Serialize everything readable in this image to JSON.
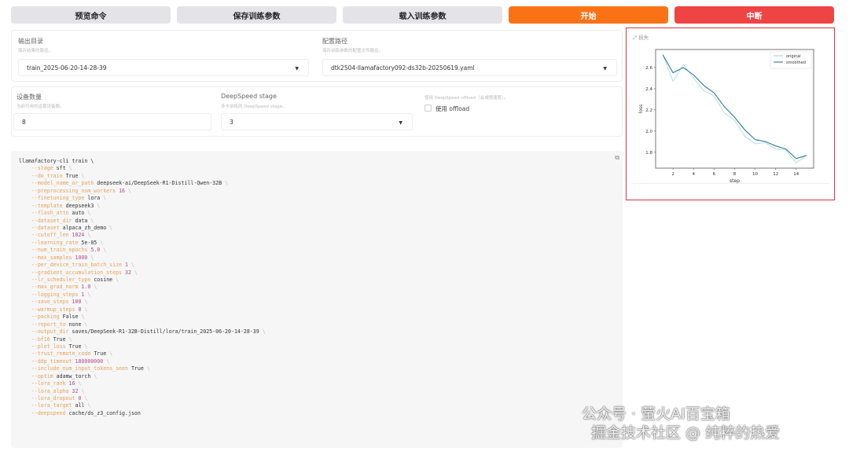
{
  "toolbar": {
    "preview": "预览命令",
    "save": "保存训练参数",
    "load": "载入训练参数",
    "start": "开始",
    "abort": "中断"
  },
  "output_dir": {
    "label": "输出目录",
    "info": "保存结果的路径。",
    "value": "train_2025-06-20-14-28-39"
  },
  "config_path": {
    "label": "配置路径",
    "info": "保存训练参数的配置文件路径。",
    "value": "dtk2504-llamafactory092-ds32b-20250619.yaml"
  },
  "device_count": {
    "label": "设备数量",
    "info": "当前可用的运算设备数。",
    "value": "8"
  },
  "ds_stage": {
    "label": "DeepSpeed stage",
    "info": "多卡训练的 DeepSpeed stage。",
    "value": "3"
  },
  "ds_offload": {
    "info": "使用 DeepSpeed offload（会减慢速度）。",
    "label": "使用 offload",
    "checked": false
  },
  "command": {
    "head": "llamafactory-cli train \\",
    "args": [
      [
        "--stage",
        "sft",
        false
      ],
      [
        "--do_train",
        "True",
        false
      ],
      [
        "--model_name_or_path",
        "deepseek-ai/DeepSeek-R1-Distill-Qwen-32B",
        false
      ],
      [
        "--preprocessing_num_workers",
        "16",
        true
      ],
      [
        "--finetuning_type",
        "lora",
        false
      ],
      [
        "--template",
        "deepseek3",
        false
      ],
      [
        "--flash_attn",
        "auto",
        false
      ],
      [
        "--dataset_dir",
        "data",
        false
      ],
      [
        "--dataset",
        "alpaca_zh_demo",
        false
      ],
      [
        "--cutoff_len",
        "1024",
        true
      ],
      [
        "--learning_rate",
        "5e-05",
        false
      ],
      [
        "--num_train_epochs",
        "5.0",
        true
      ],
      [
        "--max_samples",
        "1000",
        true
      ],
      [
        "--per_device_train_batch_size",
        "1",
        true
      ],
      [
        "--gradient_accumulation_steps",
        "32",
        true
      ],
      [
        "--lr_scheduler_type",
        "cosine",
        false
      ],
      [
        "--max_grad_norm",
        "1.0",
        true
      ],
      [
        "--logging_steps",
        "1",
        true
      ],
      [
        "--save_steps",
        "100",
        true
      ],
      [
        "--warmup_steps",
        "0",
        true
      ],
      [
        "--packing",
        "False",
        false
      ],
      [
        "--report_to",
        "none",
        false
      ],
      [
        "--output_dir",
        "saves/DeepSeek-R1-32B-Distill/lora/train_2025-06-20-14-28-39",
        false
      ],
      [
        "--bf16",
        "True",
        false
      ],
      [
        "--plot_loss",
        "True",
        false
      ],
      [
        "--trust_remote_code",
        "True",
        false
      ],
      [
        "--ddp_timeout",
        "180000000",
        true
      ],
      [
        "--include_num_input_tokens_seen",
        "True",
        false
      ],
      [
        "--optim",
        "adamw_torch",
        false
      ],
      [
        "--lora_rank",
        "16",
        true
      ],
      [
        "--lora_alpha",
        "32",
        true
      ],
      [
        "--lora_dropout",
        "0",
        true
      ],
      [
        "--lora_target",
        "all",
        false
      ],
      [
        "--deepspeed",
        "cache/ds_z3_config.json",
        false
      ]
    ]
  },
  "loss_panel": {
    "title": "损失"
  },
  "chart_data": {
    "type": "line",
    "xlabel": "step",
    "ylabel": "loss",
    "xlim": [
      0.3,
      15.7
    ],
    "ylim": [
      1.65,
      2.77
    ],
    "xticks": [
      2,
      4,
      6,
      8,
      10,
      12,
      14
    ],
    "yticks": [
      1.8,
      2.0,
      2.2,
      2.4,
      2.6
    ],
    "legend": "top-right",
    "x": [
      1,
      2,
      3,
      4,
      5,
      6,
      7,
      8,
      9,
      10,
      11,
      12,
      13,
      14,
      15
    ],
    "series": [
      {
        "name": "original",
        "color": "#a8d4e0",
        "values": [
          2.72,
          2.47,
          2.63,
          2.5,
          2.38,
          2.33,
          2.17,
          2.1,
          1.95,
          1.88,
          1.89,
          1.83,
          1.82,
          1.7,
          1.77
        ]
      },
      {
        "name": "smoothed",
        "color": "#2e7f94",
        "values": [
          2.72,
          2.55,
          2.6,
          2.53,
          2.43,
          2.36,
          2.23,
          2.13,
          2.01,
          1.92,
          1.9,
          1.86,
          1.83,
          1.74,
          1.77
        ]
      }
    ]
  },
  "watermark": {
    "line1": "公众号 · 萤火AI百宝箱",
    "line2": "掘金技术社区 @ 纯粹的热爱"
  }
}
